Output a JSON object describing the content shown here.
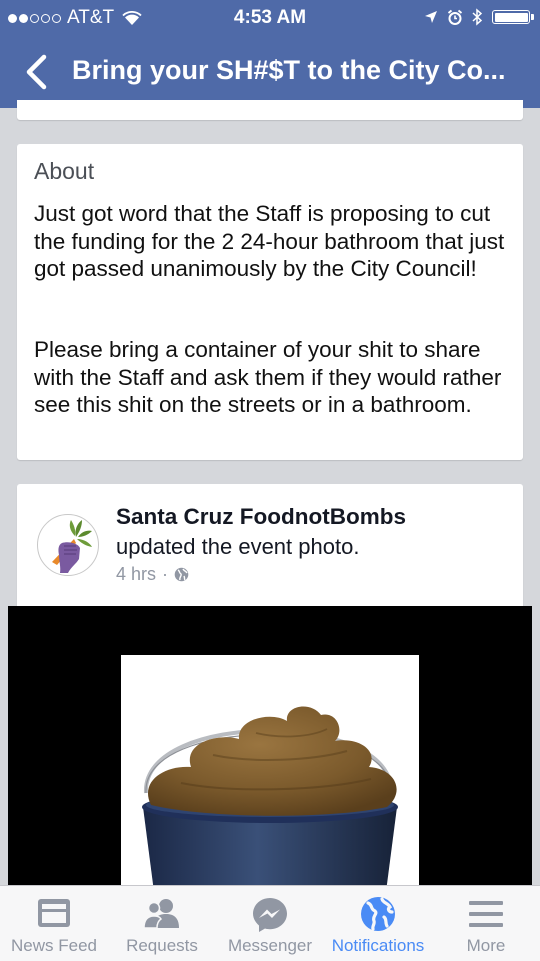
{
  "status_bar": {
    "carrier": "AT&T",
    "time": "4:53 AM",
    "signal_bars": 2
  },
  "nav": {
    "title": "Bring your SH#$T to the City Co...",
    "back_icon": "chevron-left-icon"
  },
  "about": {
    "heading": "About",
    "paragraph1": "Just got word that the Staff is proposing to cut the funding for the 2 24-hour bathroom that just got passed unanimously by the City Council!",
    "paragraph2": "Please bring a container of your shit to share with the Staff and ask them if they would rather see this shit on the streets or in a bathroom."
  },
  "post": {
    "author": "Santa Cruz FoodnotBombs",
    "action": "updated the event photo.",
    "time": "4 hrs",
    "separator": "·",
    "privacy_icon": "globe-icon"
  },
  "tabs": [
    {
      "label": "News Feed",
      "icon": "news-feed-icon",
      "active": false
    },
    {
      "label": "Requests",
      "icon": "requests-icon",
      "active": false
    },
    {
      "label": "Messenger",
      "icon": "messenger-icon",
      "active": false
    },
    {
      "label": "Notifications",
      "icon": "globe-icon",
      "active": true
    },
    {
      "label": "More",
      "icon": "menu-icon",
      "active": false
    }
  ],
  "colors": {
    "header_blue": "#4f6aa8",
    "active_tab": "#4a8bf5",
    "inactive_tab": "#9197a3",
    "page_background": "#d5d7db"
  }
}
